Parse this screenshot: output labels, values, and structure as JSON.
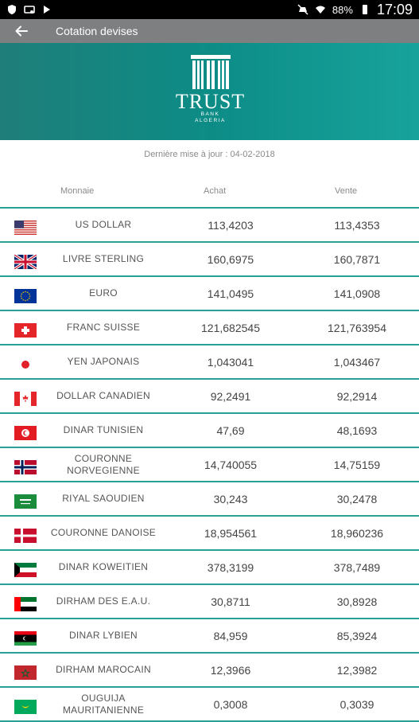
{
  "status_bar": {
    "battery": "88%",
    "time": "17:09"
  },
  "app_bar": {
    "title": "Cotation devises",
    "back_icon": "arrow-left-icon"
  },
  "banner": {
    "logo_word": "TRUST",
    "logo_sub_1": "BANK",
    "logo_sub_2": "ALGERIA"
  },
  "update": {
    "text": "Dernière mise à jour : 04-02-2018"
  },
  "table": {
    "headers": {
      "monnaie": "Monnaie",
      "achat": "Achat",
      "vente": "Vente"
    },
    "rows": [
      {
        "flag": "us",
        "name": "US DOLLAR",
        "achat": "113,4203",
        "vente": "113,4353"
      },
      {
        "flag": "gb",
        "name": "LIVRE STERLING",
        "achat": "160,6975",
        "vente": "160,7871"
      },
      {
        "flag": "eu",
        "name": "EURO",
        "achat": "141,0495",
        "vente": "141,0908"
      },
      {
        "flag": "ch",
        "name": "FRANC SUISSE",
        "achat": "121,682545",
        "vente": "121,763954"
      },
      {
        "flag": "jp",
        "name": "YEN JAPONAIS",
        "achat": "1,043041",
        "vente": "1,043467"
      },
      {
        "flag": "ca",
        "name": "DOLLAR CANADIEN",
        "achat": "92,2491",
        "vente": "92,2914"
      },
      {
        "flag": "tn",
        "name": "DINAR TUNISIEN",
        "achat": "47,69",
        "vente": "48,1693"
      },
      {
        "flag": "no",
        "name": "COURONNE NORVEGIENNE",
        "achat": "14,740055",
        "vente": "14,75159"
      },
      {
        "flag": "sa",
        "name": "RIYAL SAOUDIEN",
        "achat": "30,243",
        "vente": "30,2478"
      },
      {
        "flag": "dk",
        "name": "COURONNE DANOISE",
        "achat": "18,954561",
        "vente": "18,960236"
      },
      {
        "flag": "kw",
        "name": "DINAR KOWEITIEN",
        "achat": "378,3199",
        "vente": "378,7489"
      },
      {
        "flag": "ae",
        "name": "DIRHAM DES E.A.U.",
        "achat": "30,8711",
        "vente": "30,8928"
      },
      {
        "flag": "ly",
        "name": "DINAR LYBIEN",
        "achat": "84,959",
        "vente": "85,3924"
      },
      {
        "flag": "ma",
        "name": "DIRHAM MAROCAIN",
        "achat": "12,3966",
        "vente": "12,3982"
      },
      {
        "flag": "mr",
        "name": "OUGUIJA MAURITANIENNE",
        "achat": "0,3008",
        "vente": "0,3039"
      }
    ]
  },
  "colors": {
    "accent": "#2aa198",
    "app_bar": "#7d7f81",
    "banner": "#0d8c86"
  }
}
